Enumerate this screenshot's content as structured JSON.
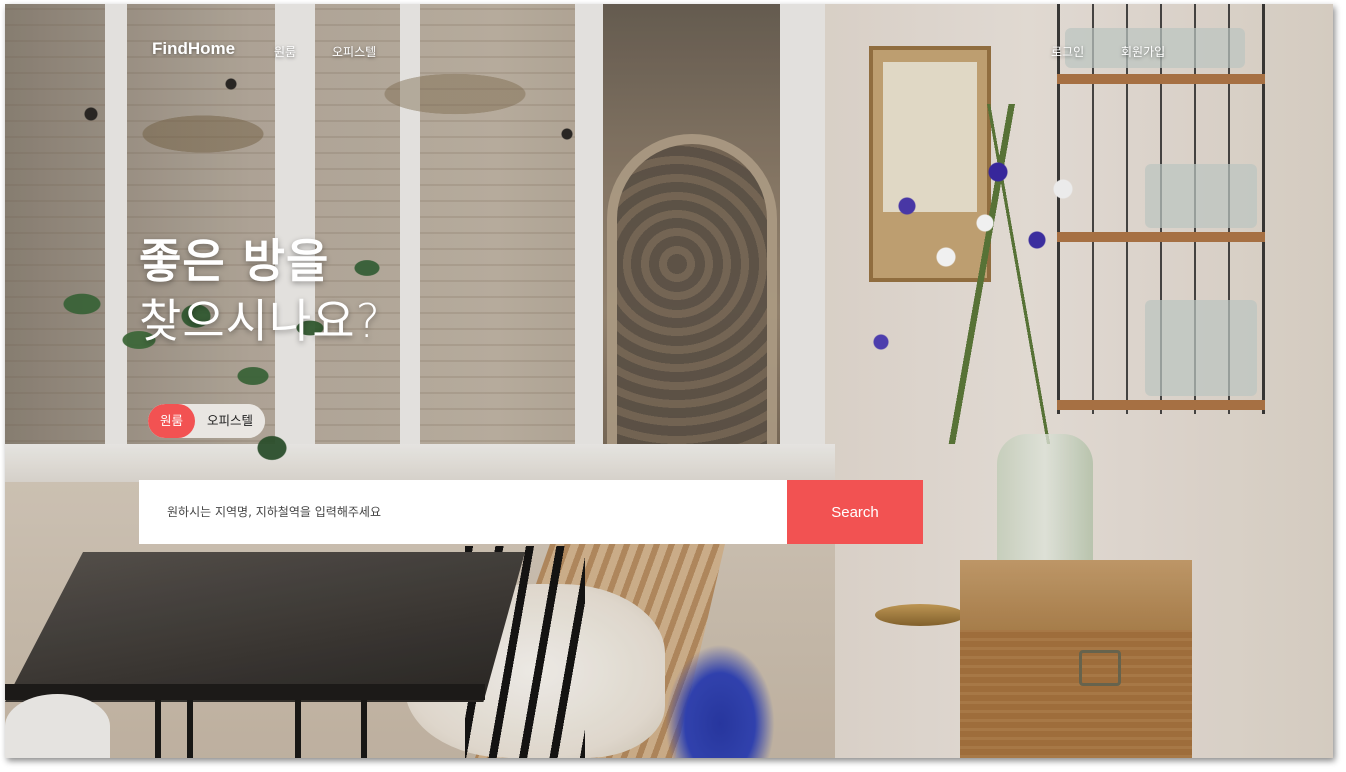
{
  "nav": {
    "logo": "FindHome",
    "links": [
      "원룸",
      "오피스텔"
    ],
    "auth": {
      "login": "로그인",
      "signup": "회원가입"
    }
  },
  "hero": {
    "line1": "좋은 방을",
    "line2": "찾으시나요?"
  },
  "room_type_toggle": {
    "options": [
      "원룸",
      "오피스텔"
    ],
    "selected": "원룸"
  },
  "search": {
    "placeholder": "원하시는 지역명, 지하철역을 입력해주세요",
    "button_label": "Search"
  },
  "colors": {
    "accent": "#f25252",
    "text_on_image": "#ffffff"
  }
}
